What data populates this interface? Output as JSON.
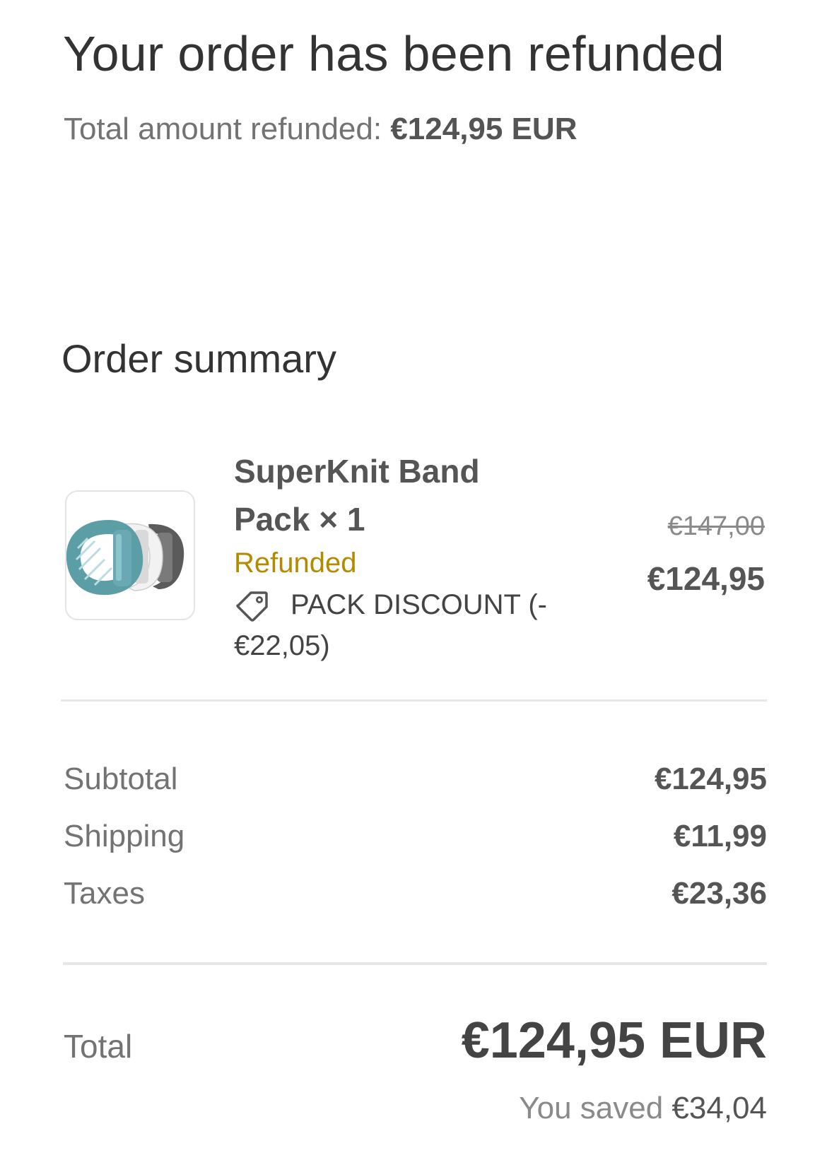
{
  "header": {
    "title": "Your order has been refunded",
    "refund_label": "Total amount refunded: ",
    "refund_amount": "€124,95 EUR"
  },
  "summary": {
    "heading": "Order summary"
  },
  "item": {
    "name": "SuperKnit Band Pack × 1",
    "status": "Refunded",
    "discount": "PACK DISCOUNT (-€22,05)",
    "original_price": "€147,00",
    "price": "€124,95",
    "status_color": "#b38a00",
    "icon": "tag-icon"
  },
  "totals": {
    "subtotal_label": "Subtotal",
    "subtotal_value": "€124,95",
    "shipping_label": "Shipping",
    "shipping_value": "€11,99",
    "taxes_label": "Taxes",
    "taxes_value": "€23,36",
    "total_label": "Total",
    "total_value": "€124,95 EUR",
    "saved_label": "You saved ",
    "saved_value": "€34,04"
  }
}
